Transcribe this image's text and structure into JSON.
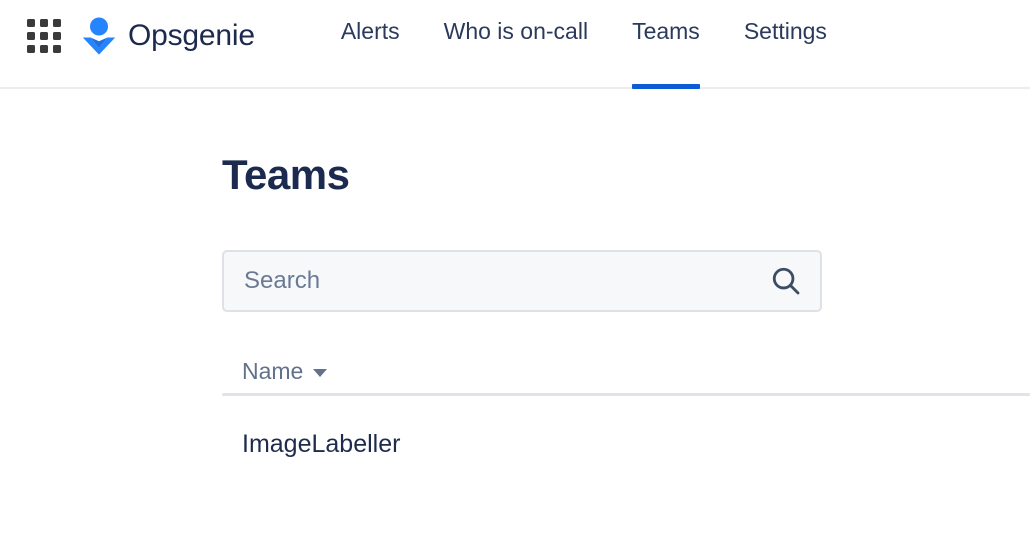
{
  "header": {
    "app_switcher_icon": "grid-apps-icon",
    "logo_icon": "opsgenie-logo-icon",
    "brand_name": "Opsgenie",
    "nav": [
      {
        "label": "Alerts",
        "active": false
      },
      {
        "label": "Who is on-call",
        "active": false
      },
      {
        "label": "Teams",
        "active": true
      },
      {
        "label": "Settings",
        "active": false
      }
    ]
  },
  "main": {
    "page_title": "Teams",
    "search": {
      "value": "",
      "placeholder": "Search",
      "icon": "search-icon"
    },
    "table": {
      "columns": [
        {
          "label": "Name",
          "sort": "desc",
          "sort_icon": "caret-down-icon"
        }
      ],
      "rows": [
        {
          "name": "ImageLabeller"
        }
      ]
    }
  },
  "colors": {
    "accent": "#0b5cd5",
    "text_dark": "#1b2a4e",
    "text_muted": "#63718b",
    "logo_blue": "#2684ff",
    "logo_blue_dark": "#1f6fe0",
    "border": "#dfe1e6",
    "divider": "#e2e3e9",
    "field_bg": "#f7f8fa"
  }
}
